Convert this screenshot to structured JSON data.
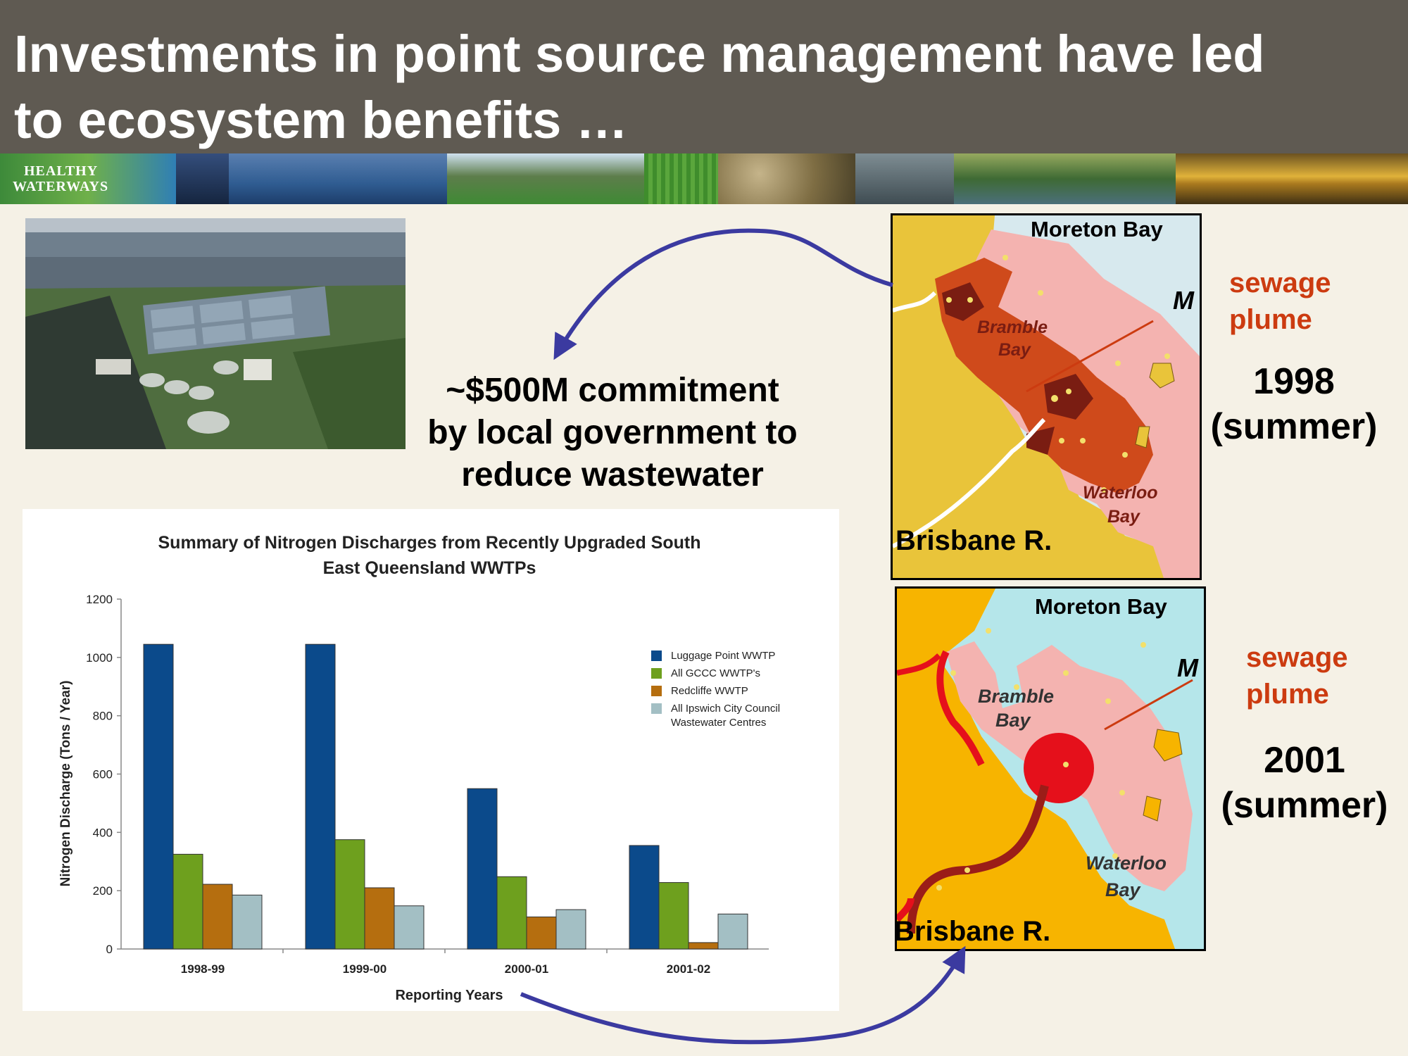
{
  "slide": {
    "title_line1": "Investments in point source management have led",
    "title_line2": "to ecosystem benefits …",
    "logo_line1": "HEALTHY",
    "logo_line2": "WATERWAYS",
    "commitment_line1": "~$500M commitment",
    "commitment_line2": "by local government to",
    "commitment_line3": "reduce wastewater"
  },
  "maps": [
    {
      "bay_label": "Moreton Bay",
      "cut_label": "M",
      "bay1_a": "Bramble",
      "bay1_b": "Bay",
      "bay2_a": "Waterloo",
      "bay2_b": "Bay",
      "river_label": "Brisbane R.",
      "plume_line1": "sewage",
      "plume_line2": "plume",
      "year": "1998",
      "season": "(summer)"
    },
    {
      "bay_label": "Moreton Bay",
      "cut_label": "M",
      "bay1_a": "Bramble",
      "bay1_b": "Bay",
      "bay2_a": "Waterloo",
      "bay2_b": "Bay",
      "river_label": "Brisbane R.",
      "plume_line1": "sewage",
      "plume_line2": "plume",
      "year": "2001",
      "season": "(summer)"
    }
  ],
  "colors": {
    "title_bg": "#5f5a52",
    "luggage": "#0b4a8b",
    "gccc": "#6ea01e",
    "redcliffe": "#b56e0f",
    "ipswich": "#a3bfc4",
    "arrow": "#3b3aa0",
    "plume_arrow": "#cc3b10"
  },
  "chart_data": {
    "type": "bar",
    "title": "Summary of Nitrogen Discharges from Recently Upgraded South East Queensland WWTPs",
    "title_line1": "Summary of Nitrogen Discharges from Recently Upgraded South",
    "title_line2": "East Queensland WWTPs",
    "xlabel": "Reporting  Years",
    "ylabel": "Nitrogen  Discharge  (Tons  /  Year)",
    "ylim": [
      0,
      1200
    ],
    "yticks": [
      0,
      200,
      400,
      600,
      800,
      1000,
      1200
    ],
    "categories": [
      "1998-99",
      "1999-00",
      "2000-01",
      "2001-02"
    ],
    "series": [
      {
        "name": "Luggage Point WWTP",
        "color": "#0b4a8b",
        "values": [
          1045,
          1045,
          550,
          355
        ]
      },
      {
        "name": "All GCCC WWTP's",
        "color": "#6ea01e",
        "values": [
          325,
          375,
          248,
          228
        ]
      },
      {
        "name": "Redcliffe WWTP",
        "color": "#b56e0f",
        "values": [
          222,
          210,
          110,
          22
        ]
      },
      {
        "name": "All Ipswich City Council Wastewater Centres",
        "color": "#a3bfc4",
        "values": [
          185,
          148,
          135,
          120
        ]
      }
    ],
    "legend_lines": [
      [
        "Luggage Point WWTP"
      ],
      [
        "All GCCC WWTP's"
      ],
      [
        "Redcliffe WWTP"
      ],
      [
        "All Ipswich City Council",
        "Wastewater Centres"
      ]
    ],
    "legend_position": "right",
    "grid": false
  }
}
